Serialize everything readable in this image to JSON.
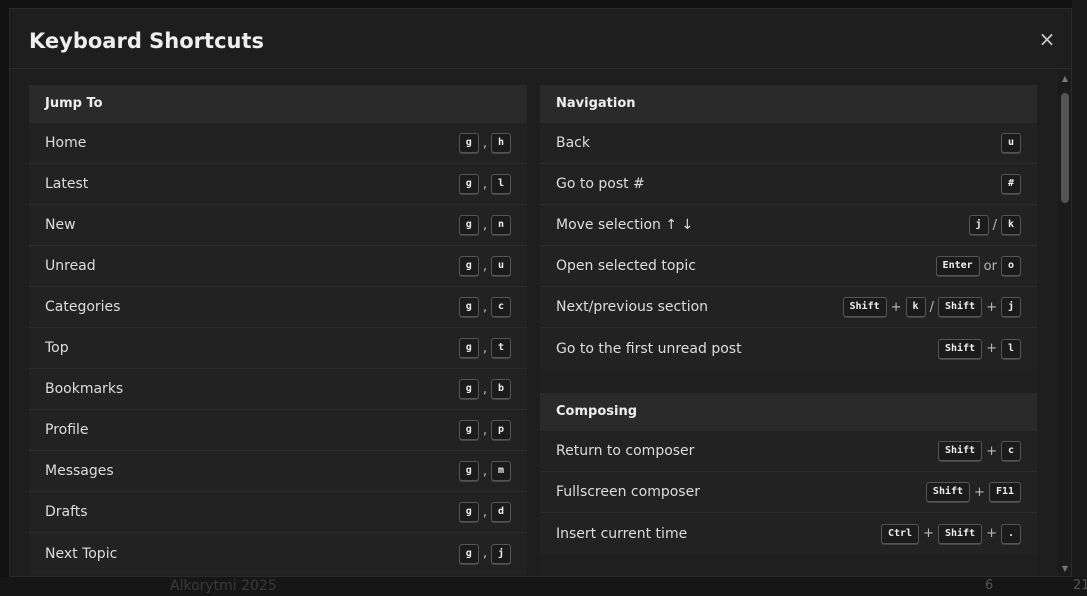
{
  "modal": {
    "title": "Keyboard Shortcuts",
    "close_icon": "×"
  },
  "background": {
    "footer_text": "Alkorytmi 2025",
    "count_left": "6",
    "count_right": "21"
  },
  "jump_to": {
    "title": "Jump To",
    "items": [
      {
        "label": "Home",
        "k1": "g",
        "sep": ",",
        "k2": "h"
      },
      {
        "label": "Latest",
        "k1": "g",
        "sep": ",",
        "k2": "l"
      },
      {
        "label": "New",
        "k1": "g",
        "sep": ",",
        "k2": "n"
      },
      {
        "label": "Unread",
        "k1": "g",
        "sep": ",",
        "k2": "u"
      },
      {
        "label": "Categories",
        "k1": "g",
        "sep": ",",
        "k2": "c"
      },
      {
        "label": "Top",
        "k1": "g",
        "sep": ",",
        "k2": "t"
      },
      {
        "label": "Bookmarks",
        "k1": "g",
        "sep": ",",
        "k2": "b"
      },
      {
        "label": "Profile",
        "k1": "g",
        "sep": ",",
        "k2": "p"
      },
      {
        "label": "Messages",
        "k1": "g",
        "sep": ",",
        "k2": "m"
      },
      {
        "label": "Drafts",
        "k1": "g",
        "sep": ",",
        "k2": "d"
      },
      {
        "label": "Next Topic",
        "k1": "g",
        "sep": ",",
        "k2": "j"
      }
    ]
  },
  "navigation": {
    "title": "Navigation",
    "back": {
      "label": "Back",
      "k": "u"
    },
    "goto": {
      "label": "Go to post #",
      "k": "#"
    },
    "move": {
      "label": "Move selection ↑ ↓",
      "k1": "j",
      "sep": "/",
      "k2": "k"
    },
    "open": {
      "label": "Open selected topic",
      "k1": "Enter",
      "sep": "or",
      "k2": "o"
    },
    "next": {
      "label": "Next/previous section",
      "k1": "Shift",
      "plus1": "+",
      "k2": "k",
      "sep": "/",
      "k3": "Shift",
      "plus2": "+",
      "k4": "j"
    },
    "first": {
      "label": "Go to the first unread post",
      "k1": "Shift",
      "plus": "+",
      "k2": "l"
    }
  },
  "composing": {
    "title": "Composing",
    "return": {
      "label": "Return to composer",
      "k1": "Shift",
      "plus": "+",
      "k2": "c"
    },
    "full": {
      "label": "Fullscreen composer",
      "k1": "Shift",
      "plus": "+",
      "k2": "F11"
    },
    "time": {
      "label": "Insert current time",
      "k1": "Ctrl",
      "plus1": "+",
      "k2": "Shift",
      "plus2": "+",
      "k3": "."
    }
  }
}
